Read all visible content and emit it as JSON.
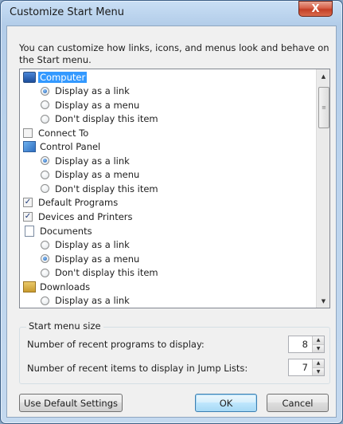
{
  "window": {
    "title": "Customize Start Menu",
    "close_glyph": "X"
  },
  "description": "You can customize how links, icons, and menus look and behave on the Start menu.",
  "list": {
    "items": [
      {
        "type": "header",
        "icon": "computer-icon",
        "label": "Computer",
        "selected": true
      },
      {
        "type": "radio",
        "label": "Display as a link",
        "checked": true
      },
      {
        "type": "radio",
        "label": "Display as a menu",
        "checked": false
      },
      {
        "type": "radio",
        "label": "Don't display this item",
        "checked": false
      },
      {
        "type": "checkbox",
        "label": "Connect To",
        "checked": false
      },
      {
        "type": "header",
        "icon": "control-panel-icon",
        "label": "Control Panel"
      },
      {
        "type": "radio",
        "label": "Display as a link",
        "checked": true
      },
      {
        "type": "radio",
        "label": "Display as a menu",
        "checked": false
      },
      {
        "type": "radio",
        "label": "Don't display this item",
        "checked": false
      },
      {
        "type": "checkbox",
        "label": "Default Programs",
        "checked": true
      },
      {
        "type": "checkbox",
        "label": "Devices and Printers",
        "checked": true
      },
      {
        "type": "header",
        "icon": "documents-icon",
        "label": "Documents"
      },
      {
        "type": "radio",
        "label": "Display as a link",
        "checked": false
      },
      {
        "type": "radio",
        "label": "Display as a menu",
        "checked": true
      },
      {
        "type": "radio",
        "label": "Don't display this item",
        "checked": false
      },
      {
        "type": "header",
        "icon": "downloads-icon",
        "label": "Downloads"
      },
      {
        "type": "radio",
        "label": "Display as a link",
        "checked": false
      }
    ]
  },
  "start_menu_size": {
    "legend": "Start menu size",
    "recent_programs_label": "Number of recent programs to display:",
    "recent_programs_value": "8",
    "jump_list_label": "Number of recent items to display in Jump Lists:",
    "jump_list_value": "7"
  },
  "buttons": {
    "default_settings": "Use Default Settings",
    "ok": "OK",
    "cancel": "Cancel"
  },
  "colors": {
    "selection": "#3399ff",
    "title_bar": "#c9dff5",
    "close_button": "#c33f26"
  }
}
